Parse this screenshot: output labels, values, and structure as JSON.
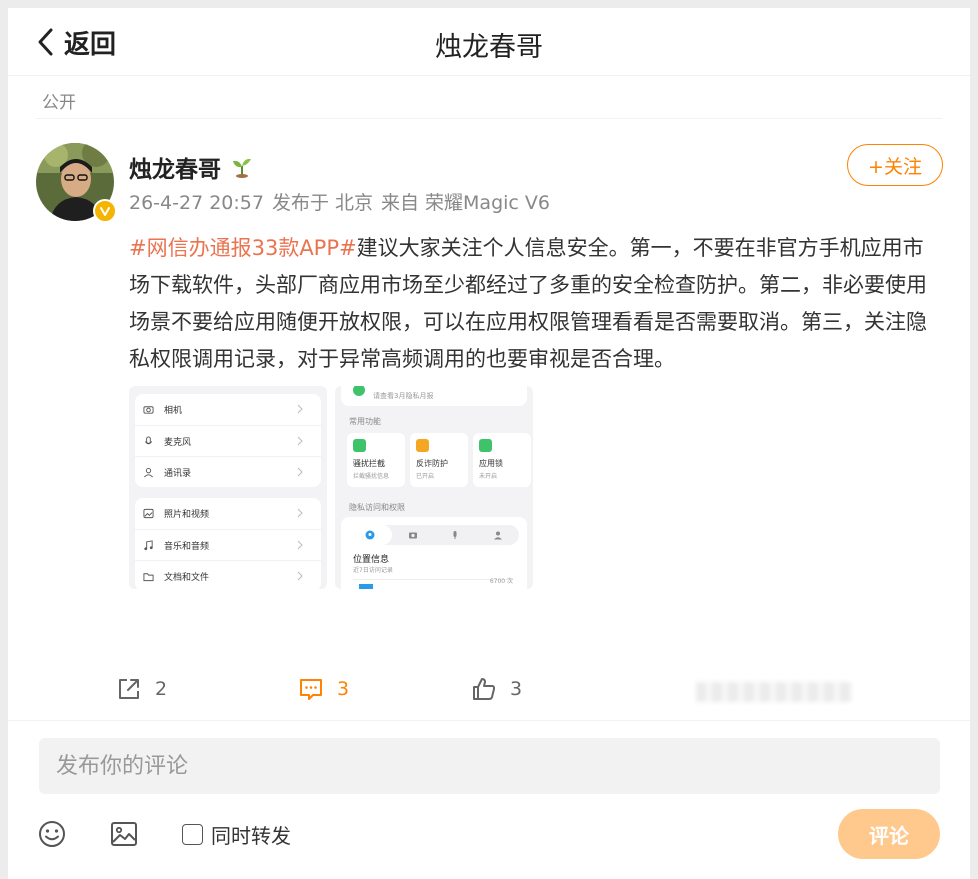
{
  "header": {
    "back_label": "返回",
    "title": "烛龙春哥"
  },
  "post": {
    "visibility": "公开",
    "author": "烛龙春哥",
    "date": "26-4-27 20:57",
    "location": "发布于 北京",
    "source": "来自 荣耀Magic V6",
    "follow_label": "+关注",
    "topic": "#网信办通报33款APP#",
    "body": "建议大家关注个人信息安全。第一，不要在非官方手机应用市场下载软件，头部厂商应用市场至少都经过了多重的安全检查防护。第二，非必要使用场景不要给应用随便开放权限，可以在应用权限管理看看是否需要取消。第三，关注隐私权限调用记录，对于异常高频调用的也要审视是否合理。",
    "images": {
      "left": {
        "group1": [
          "相机",
          "麦克风",
          "通讯录"
        ],
        "group2": [
          "照片和视频",
          "音乐和音频",
          "文档和文件"
        ]
      },
      "right": {
        "top_hint": "请查看3月隐私月报",
        "section_features": "常用功能",
        "features": [
          {
            "name": "骚扰拦截",
            "status": "拦截骚扰信息",
            "color": "#3ec26a"
          },
          {
            "name": "反诈防护",
            "status": "已开启",
            "color": "#f5a623"
          },
          {
            "name": "应用锁",
            "status": "未开启",
            "color": "#3ec26a"
          }
        ],
        "section_privacy": "隐私访问和权限",
        "privacy_title": "位置信息",
        "privacy_sub": "近7日访问记录",
        "privacy_count": "6700 次"
      }
    }
  },
  "actions": {
    "share_count": "2",
    "comment_count": "3",
    "like_count": "3"
  },
  "comment": {
    "placeholder": "发布你的评论",
    "repost_label": "同时转发",
    "submit_label": "评论"
  },
  "colors": {
    "accent": "#ff8200",
    "topic": "#eb7350",
    "submit_disabled": "#ffc98e"
  }
}
